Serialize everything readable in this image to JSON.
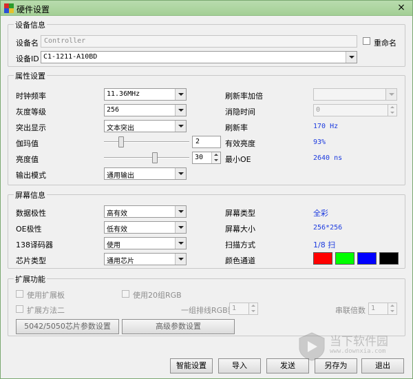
{
  "window": {
    "title": "硬件设置",
    "close_glyph": "×"
  },
  "device_info": {
    "group_title": "设备信息",
    "name_label": "设备名",
    "name_value": "Controller",
    "rename_label": "重命名",
    "id_label": "设备ID",
    "id_value": "C1-1211-A10BD"
  },
  "properties": {
    "group_title": "属性设置",
    "clock_label": "时钟频率",
    "clock_value": "11.36MHz",
    "gray_label": "灰度等级",
    "gray_value": "256",
    "highlight_label": "突出显示",
    "highlight_value": "文本突出",
    "gamma_label": "伽玛值",
    "gamma_value": "2",
    "gamma_level": 0.18,
    "brightness_label": "亮度值",
    "brightness_value": "30",
    "brightness_level": 0.6,
    "output_label": "输出模式",
    "output_value": "通用输出",
    "refresh_mult_label": "刷新率加倍",
    "refresh_mult_value": "",
    "blanking_label": "消隐时间",
    "blanking_value": "0",
    "refresh_label": "刷新率",
    "refresh_value": "170 Hz",
    "eff_brightness_label": "有效亮度",
    "eff_brightness_value": "93%",
    "min_oe_label": "最小OE",
    "min_oe_value": "2640 ns"
  },
  "screen_info": {
    "group_title": "屏幕信息",
    "data_polarity_label": "数据极性",
    "data_polarity_value": "高有效",
    "oe_polarity_label": "OE极性",
    "oe_polarity_value": "低有效",
    "decoder_label": "138译码器",
    "decoder_value": "使用",
    "chip_label": "芯片类型",
    "chip_value": "通用芯片",
    "screen_type_label": "屏幕类型",
    "screen_type_value": "全彩",
    "screen_size_label": "屏幕大小",
    "screen_size_value": "256*256",
    "scan_label": "扫描方式",
    "scan_value": "1/8 扫",
    "color_channel_label": "颜色通道",
    "colors": [
      "#ff0000",
      "#00ff00",
      "#0000ff",
      "#000000"
    ]
  },
  "extension": {
    "group_title": "扩展功能",
    "use_ext_board": "使用扩展板",
    "use_20_rgb": "使用20组RGB",
    "ext_method_two": "扩展方法二",
    "rgb_count_label": "一组排线RGB数",
    "rgb_count_value": "1",
    "cascade_label": "串联倍数",
    "cascade_value": "1",
    "chip_params_button": "5042/5050芯片参数设置",
    "advanced_params_button": "高级参数设置"
  },
  "footer": {
    "smart_button": "智能设置",
    "import_button": "导入",
    "send_button": "发送",
    "save_as_button": "另存为",
    "exit_button": "退出"
  },
  "watermark": {
    "text": "当下软件园",
    "url_text": "www.downxia.com"
  }
}
